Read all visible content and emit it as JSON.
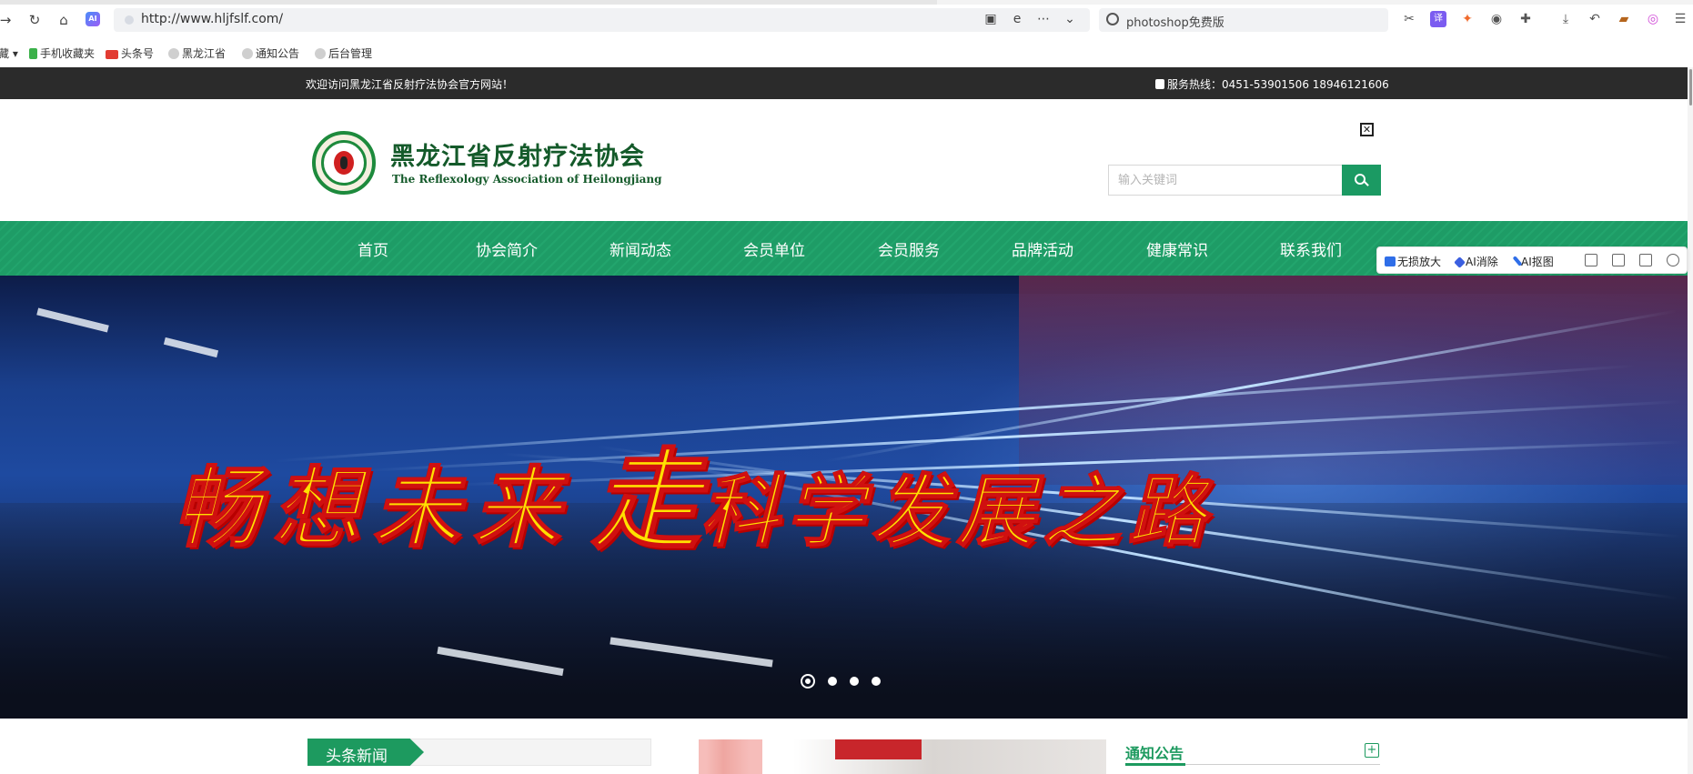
{
  "browser": {
    "url": "http://www.hljfslf.com/",
    "search_text": "photoshop免费版",
    "bookmarks": [
      "藏",
      "手机收藏夹",
      "头条号",
      "黑龙江省",
      "通知公告",
      "后台管理"
    ]
  },
  "site": {
    "welcome": "欢迎访问黑龙江省反射疗法协会官方网站！",
    "hotline": "服务热线：0451-53901506 18946121606",
    "logo_cn": "黑龙江省反射疗法协会",
    "logo_en": "The Reflexology Association of Heilongjiang",
    "search_placeholder": "输入关键词",
    "nav": [
      "首页",
      "协会简介",
      "新闻动态",
      "会员单位",
      "会员服务",
      "品牌活动",
      "健康常识",
      "联系我们"
    ],
    "banner": {
      "slogan_part1": "畅想未来",
      "slogan_part2": "走",
      "slogan_part3": "科学发展之路",
      "slide_count": 4,
      "active_slide": 1
    },
    "headline_tab": "头条新闻",
    "notice_title": "通知公告"
  },
  "side_toolbar": {
    "items": [
      "无损放大",
      "AI消除",
      "AI抠图"
    ]
  },
  "colors": {
    "brand_green": "#1d9a5f",
    "topbar": "#2b2b2b",
    "slogan_yellow": "#ffe100",
    "slogan_outline": "#d01010"
  }
}
